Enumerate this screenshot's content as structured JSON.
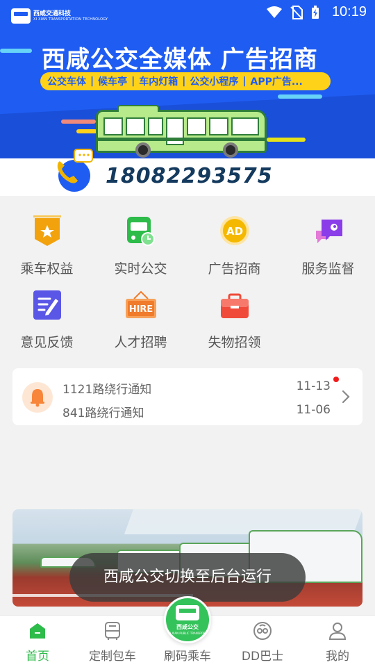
{
  "status_bar": {
    "time": "10:19",
    "icons": [
      "wifi-icon",
      "no-sim-icon",
      "battery-charging-icon"
    ]
  },
  "banner": {
    "brand_name": "西咸交通科技",
    "brand_sub": "XI XIAN TRANSPORTATION TECHNOLOGY",
    "title": "西咸公交全媒体  广告招商",
    "tags": [
      "公交车体",
      "候车亭",
      "车内灯箱",
      "公交小程序",
      "APP广告..."
    ],
    "accent_color": "#1f5df2",
    "tag_color": "#ffd21a"
  },
  "phone": {
    "number": "18082293575",
    "icon": "phone-call-icon"
  },
  "services": [
    {
      "label": "乘车权益",
      "icon": "badge-star-icon",
      "color": "#f2a20c"
    },
    {
      "label": "实时公交",
      "icon": "bus-clock-icon",
      "color": "#2dbb4a"
    },
    {
      "label": "广告招商",
      "icon": "ad-badge-icon",
      "color": "#f5b800"
    },
    {
      "label": "服务监督",
      "icon": "chat-eye-icon",
      "color": "#8a3de8"
    },
    {
      "label": "意见反馈",
      "icon": "edit-note-icon",
      "color": "#5a56e6"
    },
    {
      "label": "人才招聘",
      "icon": "hire-sign-icon",
      "color": "#f07b2a"
    },
    {
      "label": "失物招领",
      "icon": "briefcase-icon",
      "color": "#f04a3a"
    }
  ],
  "notices": [
    {
      "title": "1121路绕行通知",
      "date": "11-13",
      "unread": true
    },
    {
      "title": "841路绕行通知",
      "date": "11-06",
      "unread": false
    }
  ],
  "toast": {
    "text": "西咸公交切换至后台运行"
  },
  "bottom_nav": {
    "items": [
      {
        "label": "首页",
        "icon": "home-icon",
        "active": true
      },
      {
        "label": "定制包车",
        "icon": "bus-front-icon",
        "active": false
      },
      {
        "label": "刷码乘车",
        "icon": "scan-ride-icon",
        "active": false
      },
      {
        "label": "DD巴士",
        "icon": "dd-bus-icon",
        "active": false
      },
      {
        "label": "我的",
        "icon": "user-icon",
        "active": false
      }
    ],
    "scan_logo_text": "西咸公交",
    "scan_logo_sub": "XI XIAN PUBLIC TRANSPORT",
    "active_color": "#2dbb4a"
  }
}
